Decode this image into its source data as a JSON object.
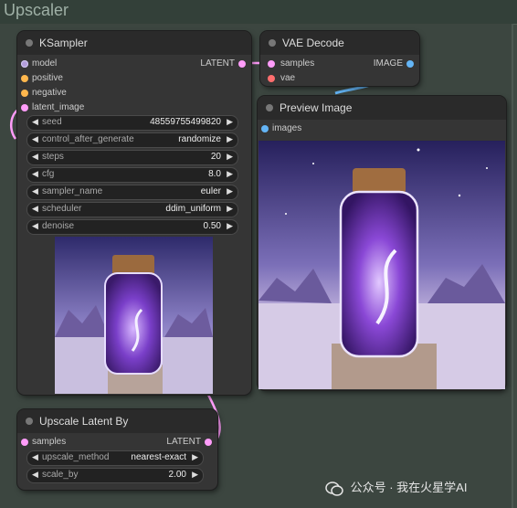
{
  "group": {
    "title": "Upscaler"
  },
  "ksampler": {
    "title": "KSampler",
    "inputs": [
      {
        "label": "model",
        "color": "#b39ddb"
      },
      {
        "label": "positive",
        "color": "#ffb74d"
      },
      {
        "label": "negative",
        "color": "#ffb74d"
      },
      {
        "label": "latent_image",
        "color": "#ff9cf9"
      }
    ],
    "output": {
      "label": "LATENT",
      "color": "#ff9cf9"
    },
    "widgets": [
      {
        "label": "seed",
        "value": "48559755499820"
      },
      {
        "label": "control_after_generate",
        "value": "randomize"
      },
      {
        "label": "steps",
        "value": "20"
      },
      {
        "label": "cfg",
        "value": "8.0"
      },
      {
        "label": "sampler_name",
        "value": "euler"
      },
      {
        "label": "scheduler",
        "value": "ddim_uniform"
      },
      {
        "label": "denoise",
        "value": "0.50"
      }
    ]
  },
  "vae_decode": {
    "title": "VAE Decode",
    "inputs": [
      {
        "label": "samples",
        "color": "#ff9cf9"
      },
      {
        "label": "vae",
        "color": "#ff6e6e"
      }
    ],
    "output": {
      "label": "IMAGE",
      "color": "#64b5f6"
    }
  },
  "preview_image": {
    "title": "Preview Image",
    "inputs": [
      {
        "label": "images",
        "color": "#64b5f6"
      }
    ]
  },
  "upscale_latent": {
    "title": "Upscale Latent By",
    "inputs": [
      {
        "label": "samples",
        "color": "#ff9cf9"
      }
    ],
    "output": {
      "label": "LATENT",
      "color": "#ff9cf9"
    },
    "widgets": [
      {
        "label": "upscale_method",
        "value": "nearest-exact"
      },
      {
        "label": "scale_by",
        "value": "2.00"
      }
    ]
  },
  "watermark": {
    "text": "公众号 · 我在火星学AI"
  },
  "icons": {
    "arrow_left": "◀",
    "arrow_right": "▶",
    "wechat": "wechat-icon"
  }
}
